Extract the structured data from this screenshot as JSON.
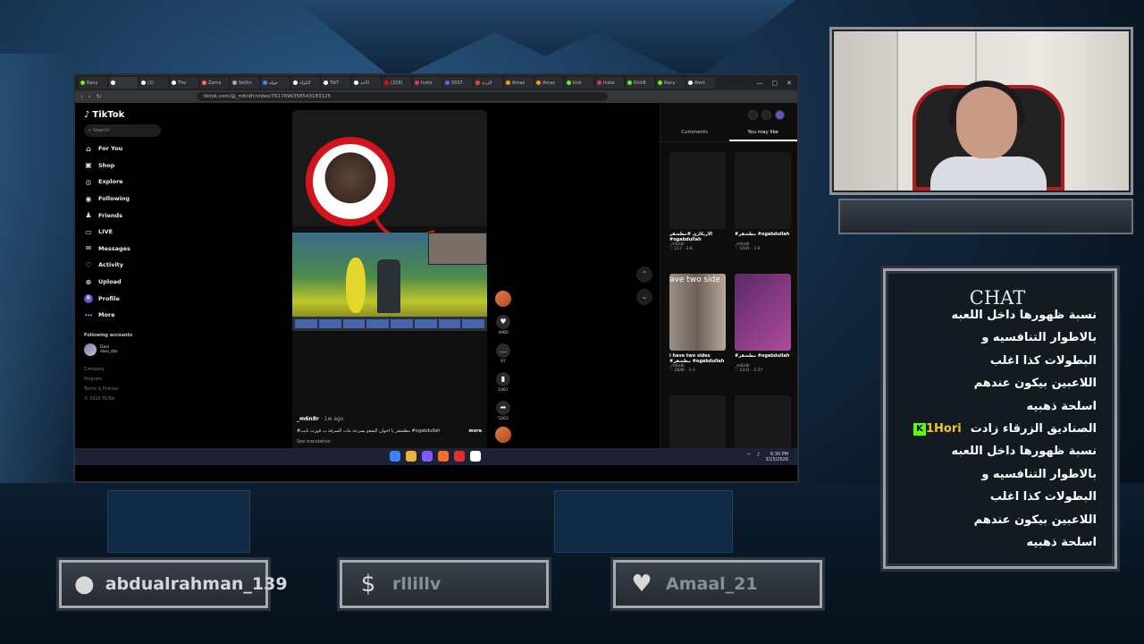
{
  "browser": {
    "tabs": [
      {
        "label": "Rany",
        "color": "#53fc18"
      },
      {
        "label": "",
        "color": "#ffffff"
      },
      {
        "label": "(2)",
        "color": "#ffffff"
      },
      {
        "label": "The",
        "color": "#ffffff"
      },
      {
        "label": "Zama",
        "color": "#ff6b6b"
      },
      {
        "label": "Settin",
        "color": "#aaaaaa"
      },
      {
        "label": "جولة",
        "color": "#4285f4"
      },
      {
        "label": "الكولة",
        "color": "#ffffff"
      },
      {
        "label": "TikT",
        "color": "#ffffff"
      },
      {
        "label": "الأحد",
        "color": "#ffffff"
      },
      {
        "label": "(329)",
        "color": "#ff0000"
      },
      {
        "label": "Insta",
        "color": "#e1306c"
      },
      {
        "label": "SSST",
        "color": "#6b5bff"
      },
      {
        "label": "البريد",
        "color": "#ea4335"
      },
      {
        "label": "Amaz",
        "color": "#ff9900"
      },
      {
        "label": "Amaz",
        "color": "#ff9900"
      },
      {
        "label": "kick",
        "color": "#53fc18"
      },
      {
        "label": "Insta",
        "color": "#e1306c"
      },
      {
        "label": "KickB",
        "color": "#53fc18"
      },
      {
        "label": "Rany",
        "color": "#53fc18"
      },
      {
        "label": "Alert",
        "color": "#ffffff"
      }
    ],
    "url": "tiktok.com/@_m6n8r/video/7617696358543183125"
  },
  "tiktok": {
    "brand": "TikTok",
    "search_placeholder": "Search",
    "nav": [
      {
        "label": "For You",
        "icon": "home-icon",
        "glyph": "⌂"
      },
      {
        "label": "Shop",
        "icon": "shop-icon",
        "glyph": "▣"
      },
      {
        "label": "Explore",
        "icon": "explore-icon",
        "glyph": "◎"
      },
      {
        "label": "Following",
        "icon": "following-icon",
        "glyph": "◉"
      },
      {
        "label": "Friends",
        "icon": "friends-icon",
        "glyph": "♟"
      },
      {
        "label": "LIVE",
        "icon": "live-icon",
        "glyph": "▭"
      },
      {
        "label": "Messages",
        "icon": "messages-icon",
        "glyph": "✉"
      },
      {
        "label": "Activity",
        "icon": "activity-icon",
        "glyph": "♡"
      },
      {
        "label": "Upload",
        "icon": "upload-icon",
        "glyph": "⊕"
      },
      {
        "label": "Profile",
        "icon": "profile-icon",
        "glyph": "R"
      },
      {
        "label": "More",
        "icon": "more-icon",
        "glyph": "⋯"
      }
    ],
    "following_title": "Following accounts",
    "following_account": {
      "name": "Dani",
      "handle": "dani_dzs"
    },
    "footer": [
      "Company",
      "Program",
      "Terms & Policies",
      "© 2026 TikTok"
    ],
    "video": {
      "author": "_m6n8r",
      "time": "· 1w ago",
      "description": "#مطشقر يا اخوان الشغو بسرعة ماب السرقة ب فورت نايت #ogabdullah",
      "more": "more",
      "translation": "See translation",
      "progress": 0.05,
      "likes": "4960",
      "comments": "97",
      "saves": "1067",
      "shares": "5263"
    },
    "right_tabs": {
      "comments": "Comments",
      "you_may_like": "You may like"
    },
    "cards": [
      {
        "caption": "الاربكاري #مطشقر #ogabdullah",
        "user": "_m6n8r",
        "stats": "♡ 217 · 3-8"
      },
      {
        "caption": "#مطشقر #ogabdullah",
        "user": "_m6n8r",
        "stats": "♡ 1501 · 3-8"
      },
      {
        "caption": "i have two sides #مطشقر #ogabdullah",
        "user": "_m6n8r",
        "stats": "♡ 2846 · 3-3"
      },
      {
        "caption": "#مطشقر #ogabdullah",
        "user": "_m6n8r",
        "stats": "♡ 2331 · 2-27"
      }
    ],
    "card_overlay_text": "ave two side"
  },
  "taskbar": {
    "time": "6:30 PM",
    "date": "3/23/2026",
    "colors": [
      "#3b82f6",
      "#e8b341",
      "#7c5cff",
      "#ff6b35",
      "#e03131",
      "#ffffff"
    ]
  },
  "chat": {
    "title": "CHAT",
    "lines_top": [
      "نسبة ظهورها داخل اللعبه",
      "بالاطوار التنافسيه و",
      "البطولات كذا اغلب",
      "اللاعبين بيكون عندهم",
      "اسلحة ذهبيه"
    ],
    "message_user": "1Hori",
    "message_lines": [
      "الصناديق الزرقاء زادت",
      "نسبة ظهورها داخل اللعبه",
      "بالاطوار التنافسيه و",
      "البطولات كذا اغلب",
      "اللاعبين بيكون عندهم",
      "اسلحة ذهبيه"
    ]
  },
  "bottom_bars": [
    {
      "icon": "user-icon",
      "text": "abdualrahman_139"
    },
    {
      "icon": "dollar-icon",
      "text": "rllillv"
    },
    {
      "icon": "heart-icon",
      "text": "Amaal_21"
    }
  ]
}
